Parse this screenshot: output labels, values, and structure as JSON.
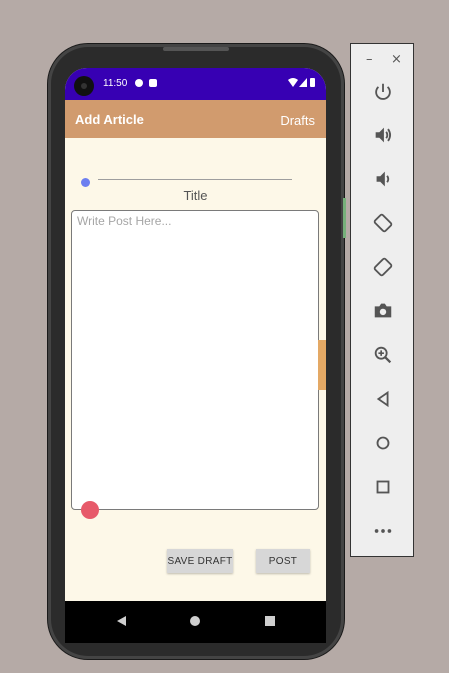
{
  "status_bar": {
    "time": "11:50"
  },
  "app_bar": {
    "title": "Add Article",
    "drafts_label": "Drafts"
  },
  "form": {
    "title_input_value": "",
    "title_label": "Title",
    "post_placeholder": "Write Post Here...",
    "post_value": ""
  },
  "buttons": {
    "save_draft_label": "SAVE DRAFT",
    "post_label": "POST"
  },
  "emulator_panel": {
    "minimize_label": "–",
    "close_label": "×",
    "tools": [
      "power-icon",
      "volume-up-icon",
      "volume-down-icon",
      "rotate-left-icon",
      "rotate-right-icon",
      "camera-icon",
      "zoom-icon",
      "back-icon",
      "home-icon",
      "overview-icon",
      "more-icon"
    ]
  },
  "colors": {
    "status_bar": "#3700b3",
    "app_bar": "#d19b6e",
    "background": "#fdf8e8",
    "accent_blue": "#6d7ff0",
    "accent_red": "#e75a6a"
  }
}
